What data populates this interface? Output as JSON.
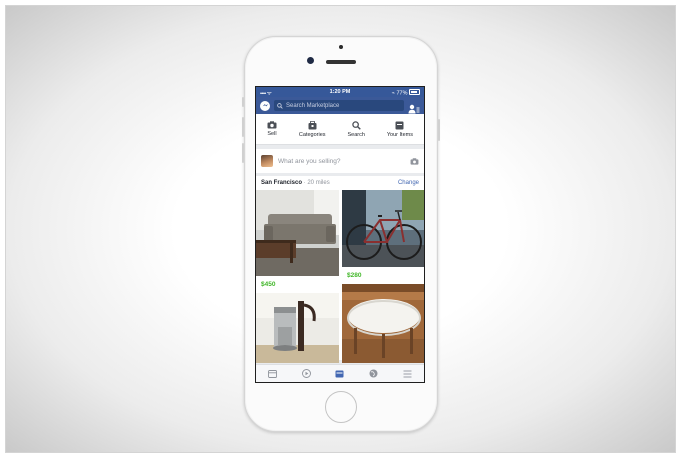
{
  "status_bar": {
    "carrier": "•••• ᯤ",
    "time": "1:20 PM",
    "battery": "⌁ 77%"
  },
  "nav": {
    "search_placeholder": "Search Marketplace"
  },
  "actions": [
    {
      "label": "Sell",
      "icon": "camera-icon"
    },
    {
      "label": "Categories",
      "icon": "tag-icon"
    },
    {
      "label": "Search",
      "icon": "search-icon"
    },
    {
      "label": "Your Items",
      "icon": "inbox-icon"
    }
  ],
  "compose": {
    "prompt": "What are you selling?"
  },
  "location": {
    "city": "San Francisco",
    "distance": " · 20 miles",
    "change_label": "Change"
  },
  "listings": [
    {
      "price": "$450",
      "item": "sofa-photo"
    },
    {
      "price": "$280",
      "item": "bicycle-photo"
    },
    {
      "price": "",
      "item": "coffee-maker-photo"
    },
    {
      "price": "",
      "item": "table-photo"
    }
  ],
  "tabs": [
    {
      "icon": "news-feed-icon",
      "active": false
    },
    {
      "icon": "video-icon",
      "active": false
    },
    {
      "icon": "marketplace-icon",
      "active": true
    },
    {
      "icon": "globe-icon",
      "active": false
    },
    {
      "icon": "menu-icon",
      "active": false
    }
  ],
  "colors": {
    "brand_blue": "#3b5998",
    "price_green": "#42b72a",
    "link_blue": "#4267b2"
  }
}
